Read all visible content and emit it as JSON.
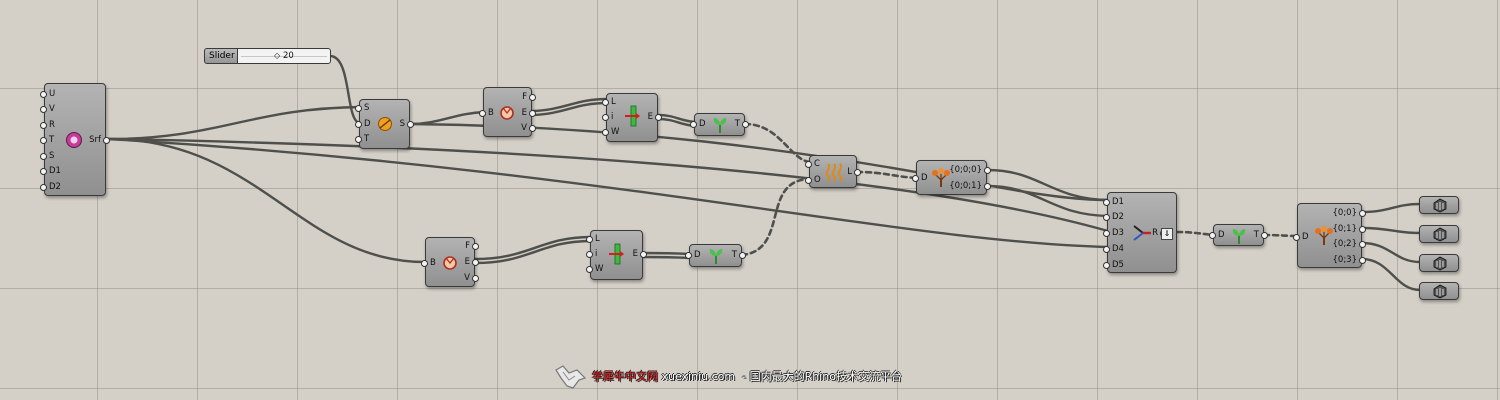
{
  "slider": {
    "label": "Slider",
    "value": "20"
  },
  "surface_param": {
    "inputs": [
      "U",
      "V",
      "R",
      "T",
      "S",
      "D1",
      "D2"
    ],
    "output": "Srf"
  },
  "scale": {
    "inputs": [
      "S",
      "D",
      "T"
    ],
    "output": "S"
  },
  "brep_edges_top": {
    "input": "B",
    "outputs": [
      "F",
      "E",
      "V"
    ]
  },
  "brep_edges_bottom": {
    "input": "B",
    "outputs": [
      "F",
      "E",
      "V"
    ]
  },
  "divide_top": {
    "inputs": [
      "L",
      "i",
      "W"
    ],
    "output": "E"
  },
  "divide_bottom": {
    "inputs": [
      "L",
      "i",
      "W"
    ],
    "output": "E"
  },
  "graft_top": {
    "input": "D",
    "output": "T"
  },
  "graft_bottom": {
    "input": "D",
    "output": "T"
  },
  "graft_right": {
    "input": "D",
    "output": "T"
  },
  "weave": {
    "inputs": [
      "C",
      "O"
    ],
    "output": "L"
  },
  "explode_tree_1": {
    "input": "D",
    "outputs": [
      "{0;0;0}",
      "{0;0;1}"
    ]
  },
  "merge": {
    "inputs": [
      "D1",
      "D2",
      "D3",
      "D4",
      "D5"
    ],
    "output": "R"
  },
  "explode_tree_2": {
    "input": "D",
    "outputs": [
      "{0;0}",
      "{0;1}",
      "{0;2}",
      "{0;3}"
    ]
  },
  "colors": {
    "canvas": "#d4d0c8",
    "wire": "#4f4f4b",
    "component": "#a0a0a0"
  },
  "watermark": {
    "brand": "学犀牛中文网",
    "text": " xuexiniu.com  - 国内最大的Rhino技术交流平台"
  }
}
